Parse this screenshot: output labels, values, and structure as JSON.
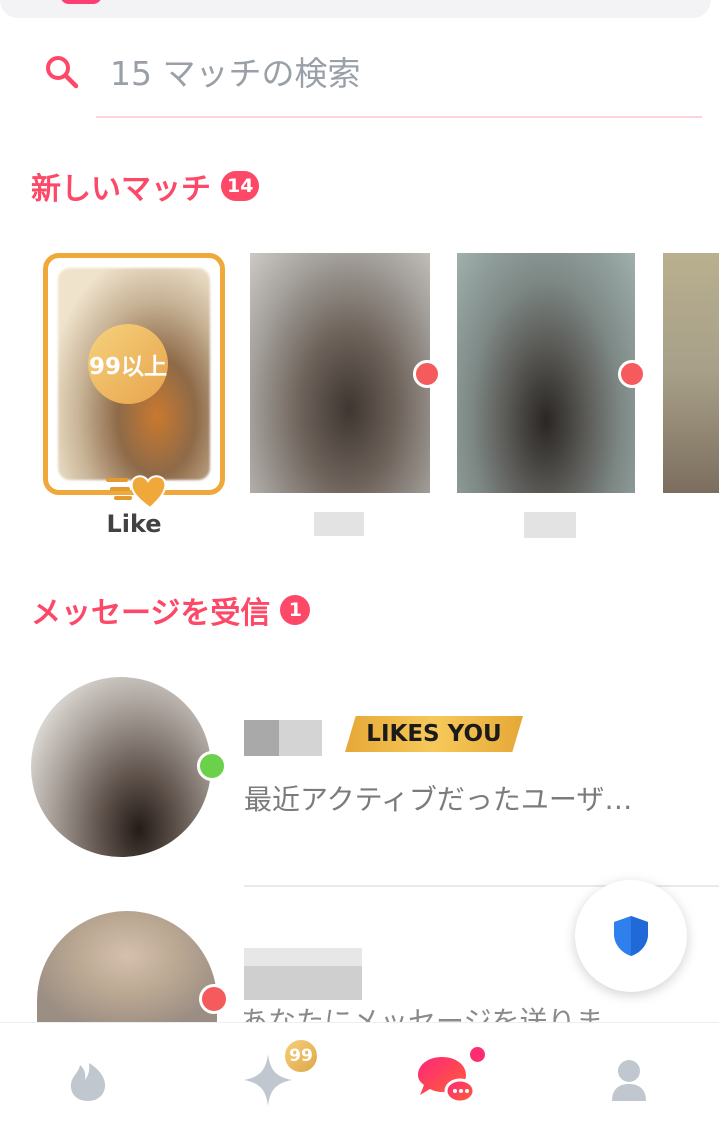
{
  "search": {
    "placeholder": "15 マッチの検索"
  },
  "new_matches": {
    "title": "新しいマッチ",
    "count": "14",
    "like_card": {
      "count_label": "99以上",
      "label": "Like"
    }
  },
  "messages": {
    "title": "メッセージを受信",
    "count": "1",
    "items": [
      {
        "preview": "最近アクティブだったユーザ…",
        "badge": "LIKES YOU"
      },
      {
        "preview": "あなたにメッセージを送りま"
      }
    ]
  },
  "bottom_nav": {
    "gold_badge": "99"
  },
  "colors": {
    "accent": "#fd4867",
    "gold": "#f0a83a",
    "online": "#6cd14a",
    "unread": "#f55a5d",
    "safety_shield": "#2f80ed"
  }
}
